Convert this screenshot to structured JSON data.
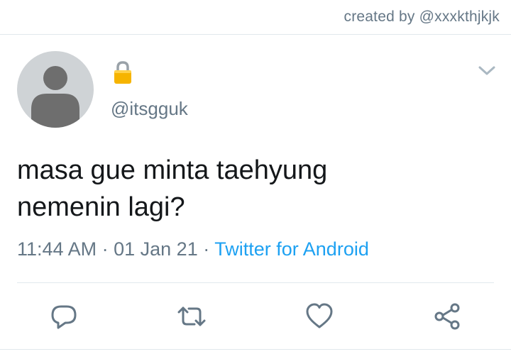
{
  "header": {
    "credit": "created by @xxxkthjkjk"
  },
  "tweet": {
    "handle": "@itsgguk",
    "text_line1": "masa gue minta taehyung",
    "text_line2": "nemenin lagi?",
    "time": "11:44 AM",
    "date": "01 Jan 21",
    "separator": "·",
    "source": "Twitter for Android"
  },
  "icons": {
    "lock": "lock-icon",
    "menu": "chevron-down-icon",
    "reply": "reply-icon",
    "retweet": "retweet-icon",
    "like": "heart-icon",
    "share": "share-icon"
  },
  "colors": {
    "text": "#14171a",
    "secondary": "#657786",
    "link": "#1da1f2",
    "avatar_bg": "#cfd3d6",
    "avatar_fg": "#6e6e6e",
    "lock": "#f6b400"
  }
}
